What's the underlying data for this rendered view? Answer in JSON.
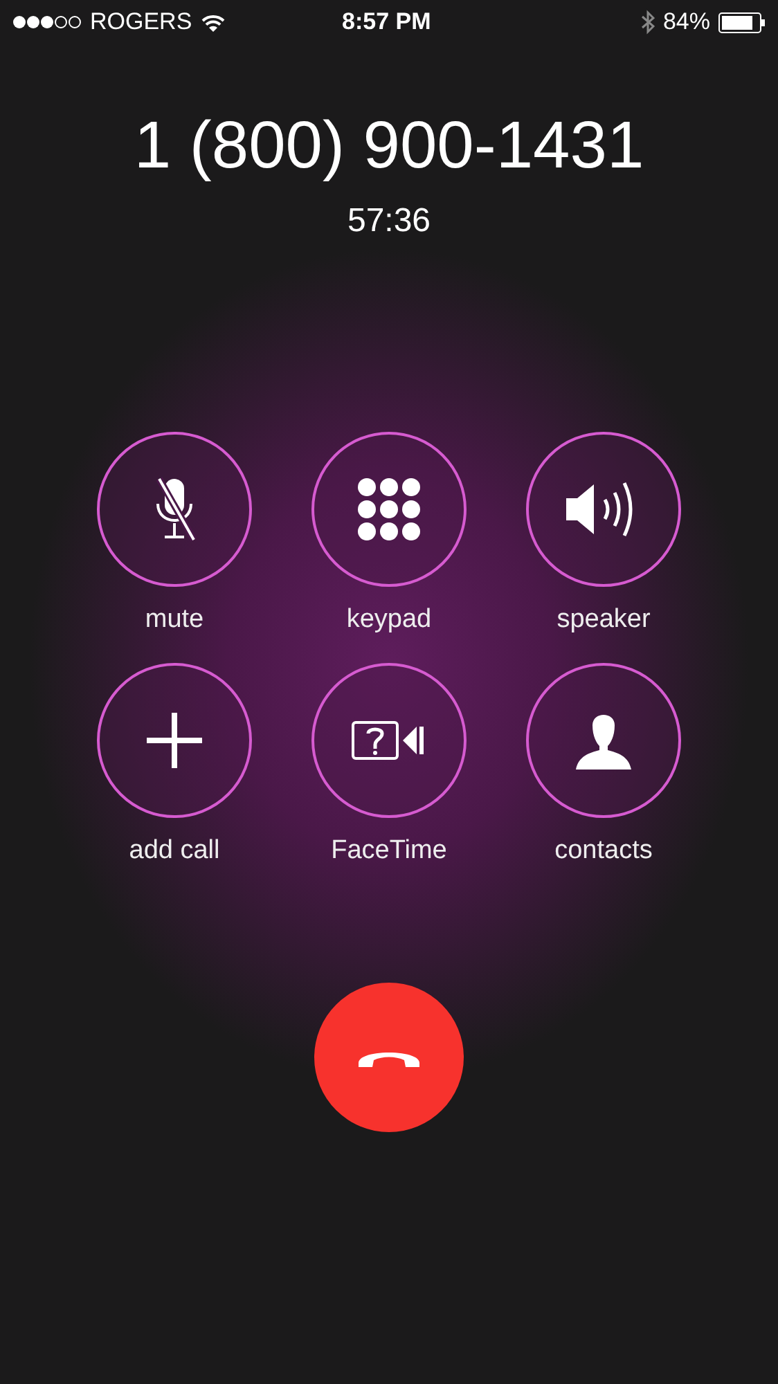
{
  "status_bar": {
    "carrier": "ROGERS",
    "time": "8:57 PM",
    "battery": "84%"
  },
  "call": {
    "number": "1 (800) 900-1431",
    "duration": "57:36"
  },
  "buttons": [
    {
      "kind": "mute",
      "label": "mute"
    },
    {
      "kind": "keypad",
      "label": "keypad"
    },
    {
      "kind": "speaker",
      "label": "speaker"
    },
    {
      "kind": "add",
      "label": "add call"
    },
    {
      "kind": "facetime",
      "label": "FaceTime"
    },
    {
      "kind": "contacts",
      "label": "contacts"
    }
  ]
}
